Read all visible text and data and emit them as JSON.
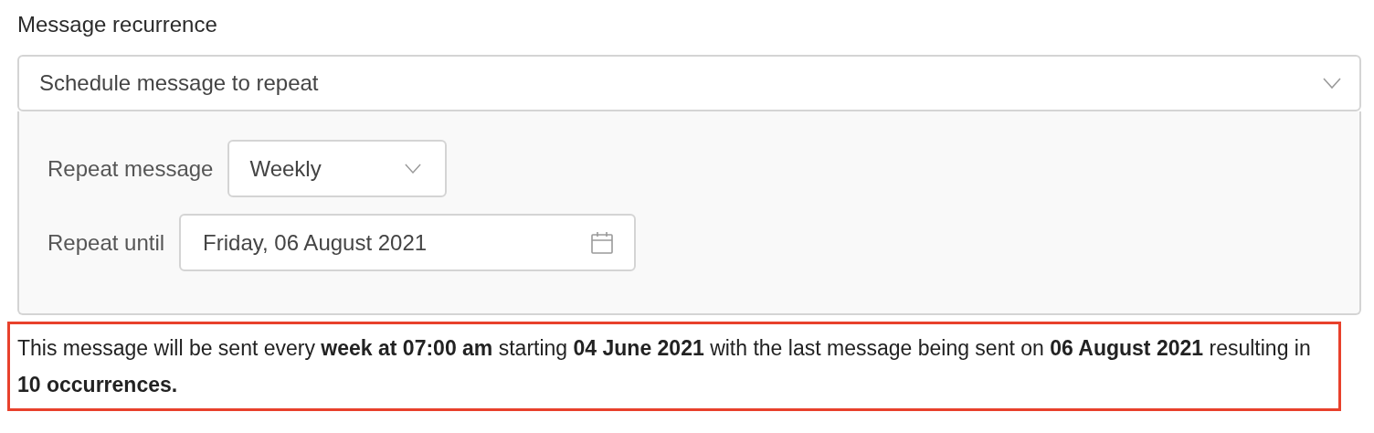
{
  "recurrence": {
    "label": "Message recurrence",
    "select": {
      "value": "Schedule message to repeat"
    },
    "fields": [
      {
        "kind": "select",
        "label": "Repeat message",
        "value": "Weekly"
      },
      {
        "kind": "date",
        "label": "Repeat until",
        "value": "Friday, 06 August 2021"
      }
    ]
  },
  "summary": {
    "text": "This message will be sent every **week at 07:00 am** starting **04 June 2021** with the last message being sent on **06 August 2021** resulting in **10 occurrences.**"
  }
}
